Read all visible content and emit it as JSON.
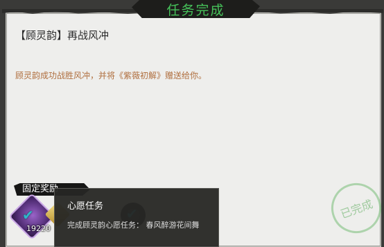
{
  "header": {
    "title": "任务完成"
  },
  "quest": {
    "name": "【顾灵韵】再战风冲",
    "description": "顾灵韵成功战胜风冲，并将《紫薇初解》赠送给你。"
  },
  "rewards": {
    "label": "固定奖励",
    "items": [
      {
        "icon": "purple-crystal-icon",
        "count": "19220",
        "checked": true
      },
      {
        "icon": "gold-gem-icon",
        "checked": true
      },
      {
        "icon": "dark-orb-icon",
        "checked": true
      }
    ]
  },
  "tooltip": {
    "title": "心愿任务",
    "body": "完成顾灵韵心愿任务：   春风醉游花间舞"
  },
  "stamp": {
    "text": "已完成"
  },
  "colors": {
    "title": "#46c25a",
    "description": "#b06f3f",
    "check": "#2fb6c9"
  }
}
